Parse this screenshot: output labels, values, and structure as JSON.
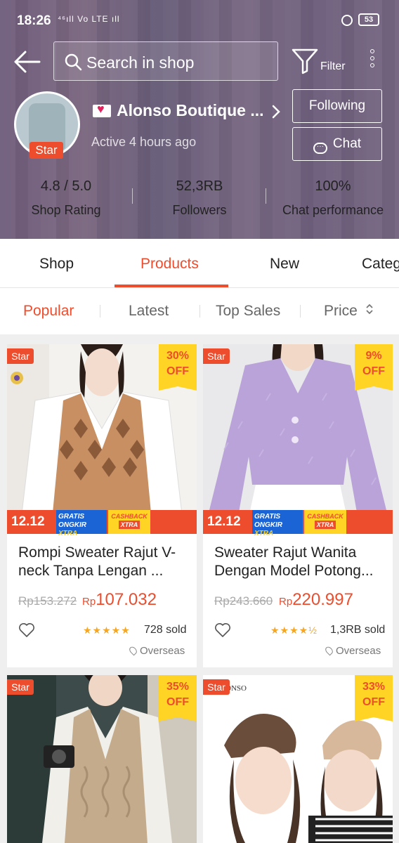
{
  "status_bar": {
    "time": "18:26",
    "signal": "⁴⁶ıll Vo LTE ıll",
    "battery": "53"
  },
  "search": {
    "placeholder": "Search in shop"
  },
  "filter_label": "Filter",
  "shop": {
    "name": "Alonso Boutique ...",
    "badge": "Star",
    "active_status": "Active 4 hours ago",
    "following_label": "Following",
    "chat_label": "Chat",
    "stats": [
      {
        "value": "4.8 / 5.0",
        "label": "Shop Rating"
      },
      {
        "value": "52,3RB",
        "label": "Followers"
      },
      {
        "value": "100%",
        "label": "Chat performance"
      }
    ]
  },
  "tabs": [
    "Shop",
    "Products",
    "New",
    "Categ"
  ],
  "active_tab": "Products",
  "sorts": [
    "Popular",
    "Latest",
    "Top Sales",
    "Price"
  ],
  "accent_color": "#ee4d2d",
  "products": [
    {
      "badge": "Star",
      "discount_pct": "30%",
      "discount_off": "OFF",
      "promo_date": "12.12",
      "promo_ongkir": [
        "GRATIS",
        "ONGKIR",
        "XTRA"
      ],
      "promo_cashback": [
        "CASHBACK",
        "XTRA"
      ],
      "title": "Rompi Sweater Rajut V-neck Tanpa Lengan ...",
      "original_price": "Rp153.272",
      "price_currency": "Rp",
      "price_value": "107.032",
      "stars": "★★★★★",
      "rating": 5,
      "sold": "728 sold",
      "location": "Overseas"
    },
    {
      "badge": "Star",
      "discount_pct": "9%",
      "discount_off": "OFF",
      "promo_date": "12.12",
      "promo_ongkir": [
        "GRATIS",
        "ONGKIR",
        "XTRA"
      ],
      "promo_cashback": [
        "CASHBACK",
        "XTRA"
      ],
      "title": "Sweater Rajut Wanita Dengan Model Potong...",
      "original_price": "Rp243.660",
      "price_currency": "Rp",
      "price_value": "220.997",
      "stars": "★★★★½",
      "rating": 4.5,
      "sold": "1,3RB sold",
      "location": "Overseas"
    },
    {
      "badge": "Star",
      "discount_pct": "35%",
      "discount_off": "OFF"
    },
    {
      "badge": "Star",
      "discount_pct": "33%",
      "discount_off": "OFF",
      "image_text": "ONSO"
    }
  ]
}
